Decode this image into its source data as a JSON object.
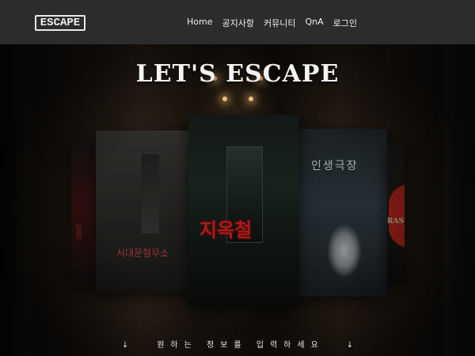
{
  "nav": {
    "logo_text": "ESCAPE",
    "links": [
      "Home",
      "공지사항",
      "커뮤니티",
      "QnA",
      "로그인"
    ]
  },
  "hero": {
    "headline": "LET'S ESCAPE"
  },
  "posters": {
    "far_left_title": "탈출",
    "left_title": "서대문형무소",
    "center_title": "지옥철",
    "right_title": "인생극장",
    "far_right_title": "RASS"
  },
  "hint": {
    "arrow_left": "↓",
    "text": "원하는 정보를 입력하세요",
    "arrow_right": "↓"
  },
  "icons": {
    "arrow": "down-arrow-icon"
  },
  "colors": {
    "navbar_bg": "#2c2c2c",
    "nav_text": "#f2f2f2",
    "accent_red": "#b01818"
  }
}
